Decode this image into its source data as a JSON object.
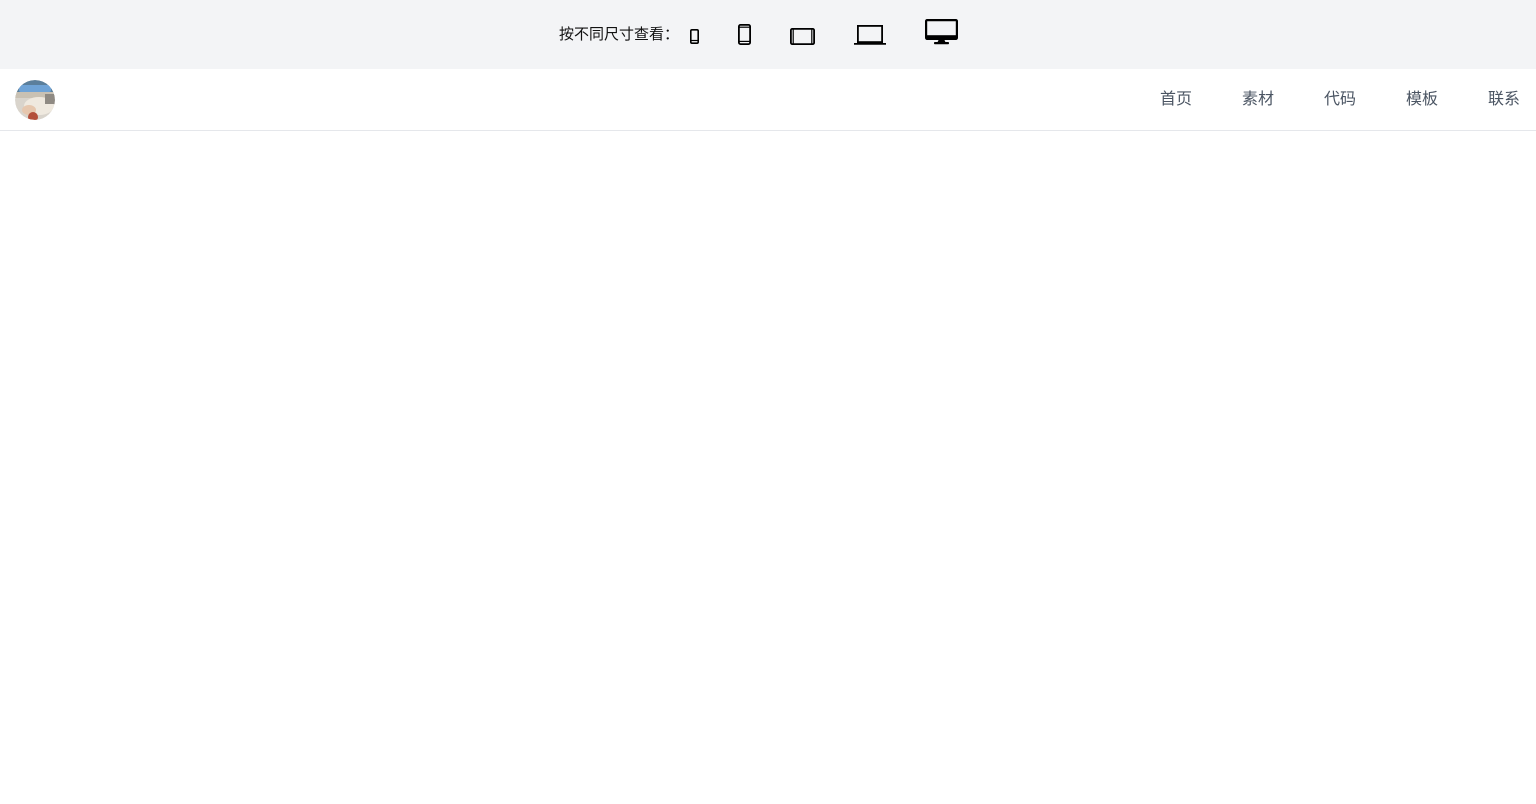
{
  "device_bar": {
    "label": "按不同尺寸查看：",
    "devices": [
      {
        "icon": "phone-small-icon"
      },
      {
        "icon": "phone-icon"
      },
      {
        "icon": "tablet-landscape-icon"
      },
      {
        "icon": "laptop-icon"
      },
      {
        "icon": "desktop-icon",
        "selected": true
      }
    ]
  },
  "navbar": {
    "avatar_icon": "avatar-image",
    "links": [
      {
        "label": "首页"
      },
      {
        "label": "素材"
      },
      {
        "label": "代码"
      },
      {
        "label": "模板"
      },
      {
        "label": "联系"
      }
    ]
  },
  "colors": {
    "device_bar_bg": "#f3f4f6",
    "nav_text": "#4b5563",
    "divider": "#e5e7eb"
  }
}
